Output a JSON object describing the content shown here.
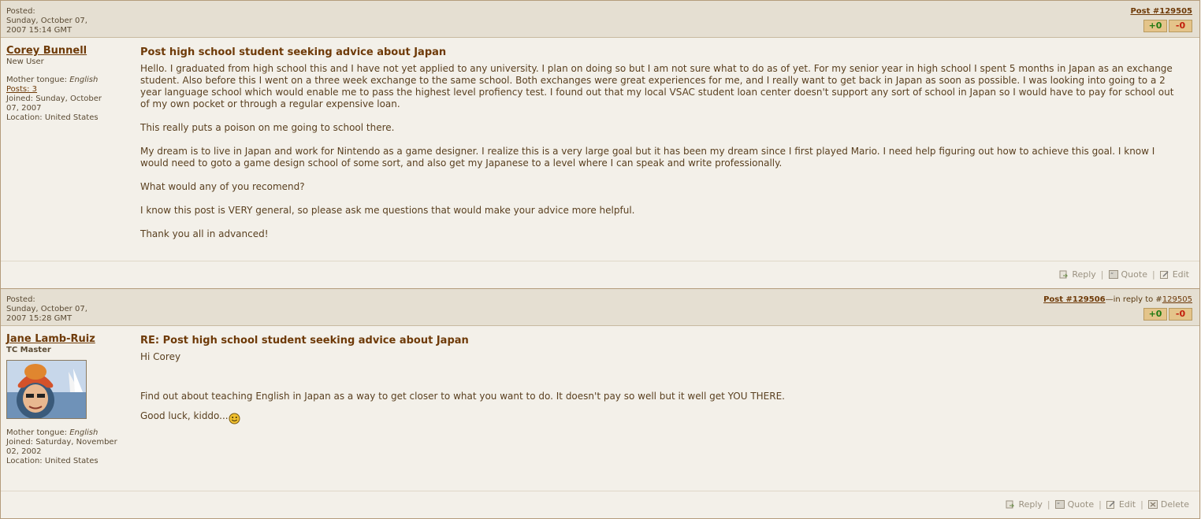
{
  "posts": [
    {
      "posted_label": "Posted:",
      "posted_date": "Sunday, October 07,",
      "posted_time": "2007 15:14 GMT",
      "post_link": "Post #129505",
      "vote_plus": "+0",
      "vote_minus": "-0",
      "author": {
        "name": "Corey Bunnell",
        "rank": "New User",
        "tongue_label": "Mother tongue:",
        "tongue": "English",
        "posts": "Posts: 3",
        "joined_1": "Joined: Sunday, October",
        "joined_2": "07, 2007",
        "location": "Location: United States"
      },
      "title": "Post high school student seeking advice about Japan",
      "paragraphs": [
        "Hello. I graduated from high school this and I have not yet applied to any university. I plan on doing so but I am not sure what to do as of yet. For my senior year in high school I spent 5 months in Japan as an exchange student. Also before this I went on a three week exchange to the same school. Both exchanges were great experiences for me, and I really want to get back in Japan as soon as possible. I was looking into going to a 2 year language school which would enable me to pass the highest level profiency test. I found out that my local VSAC student loan center doesn't support any sort of school in Japan so I would have to pay for school out of my own pocket or through a regular expensive loan.",
        "This really puts a poison on me going to school there.",
        "My dream is to live in Japan and work for Nintendo as a game designer. I realize this is a very large goal but it has been my dream since I first played Mario. I need help figuring out how to achieve this goal. I know I would need to goto a game design school of some sort, and also get my Japanese to a level where I can speak and write professionally.",
        "What would any of you recomend?",
        "I know this post is VERY general, so please ask me questions that would make your advice more helpful.",
        "Thank you all in advanced!"
      ],
      "actions": [
        "Reply",
        "Quote",
        "Edit"
      ]
    },
    {
      "posted_label": "Posted:",
      "posted_date": "Sunday, October 07,",
      "posted_time": "2007 15:28 GMT",
      "post_link": "Post #129506",
      "reply_text": "—in reply to #",
      "reply_link": "129505",
      "vote_plus": "+0",
      "vote_minus": "-0",
      "author": {
        "name": "Jane Lamb-Ruiz",
        "rank": "TC Master",
        "tongue_label": "Mother tongue:",
        "tongue": "English",
        "joined_1": "Joined: Saturday, November",
        "joined_2": "02, 2002",
        "location": "Location: United States"
      },
      "title": "RE: Post high school student seeking advice about Japan",
      "greeting": "Hi Corey",
      "paragraphs": [
        "Find out about teaching English in Japan as a way to get closer to what you want to do. It doesn't pay so well but it well get YOU THERE.",
        "Good luck, kiddo..."
      ],
      "actions": [
        "Reply",
        "Quote",
        "Edit",
        "Delete"
      ]
    }
  ],
  "icons": {
    "reply": "reply-icon",
    "quote": "quote-icon",
    "edit": "edit-icon",
    "delete": "delete-icon",
    "smiley": "smiley-icon"
  },
  "colors": {
    "header_bg": "#e5dfd2",
    "body_bg": "#f3f0e9",
    "link": "#6e3a08",
    "vote_plus": "#1f7a11",
    "vote_minus": "#c21c0c"
  }
}
